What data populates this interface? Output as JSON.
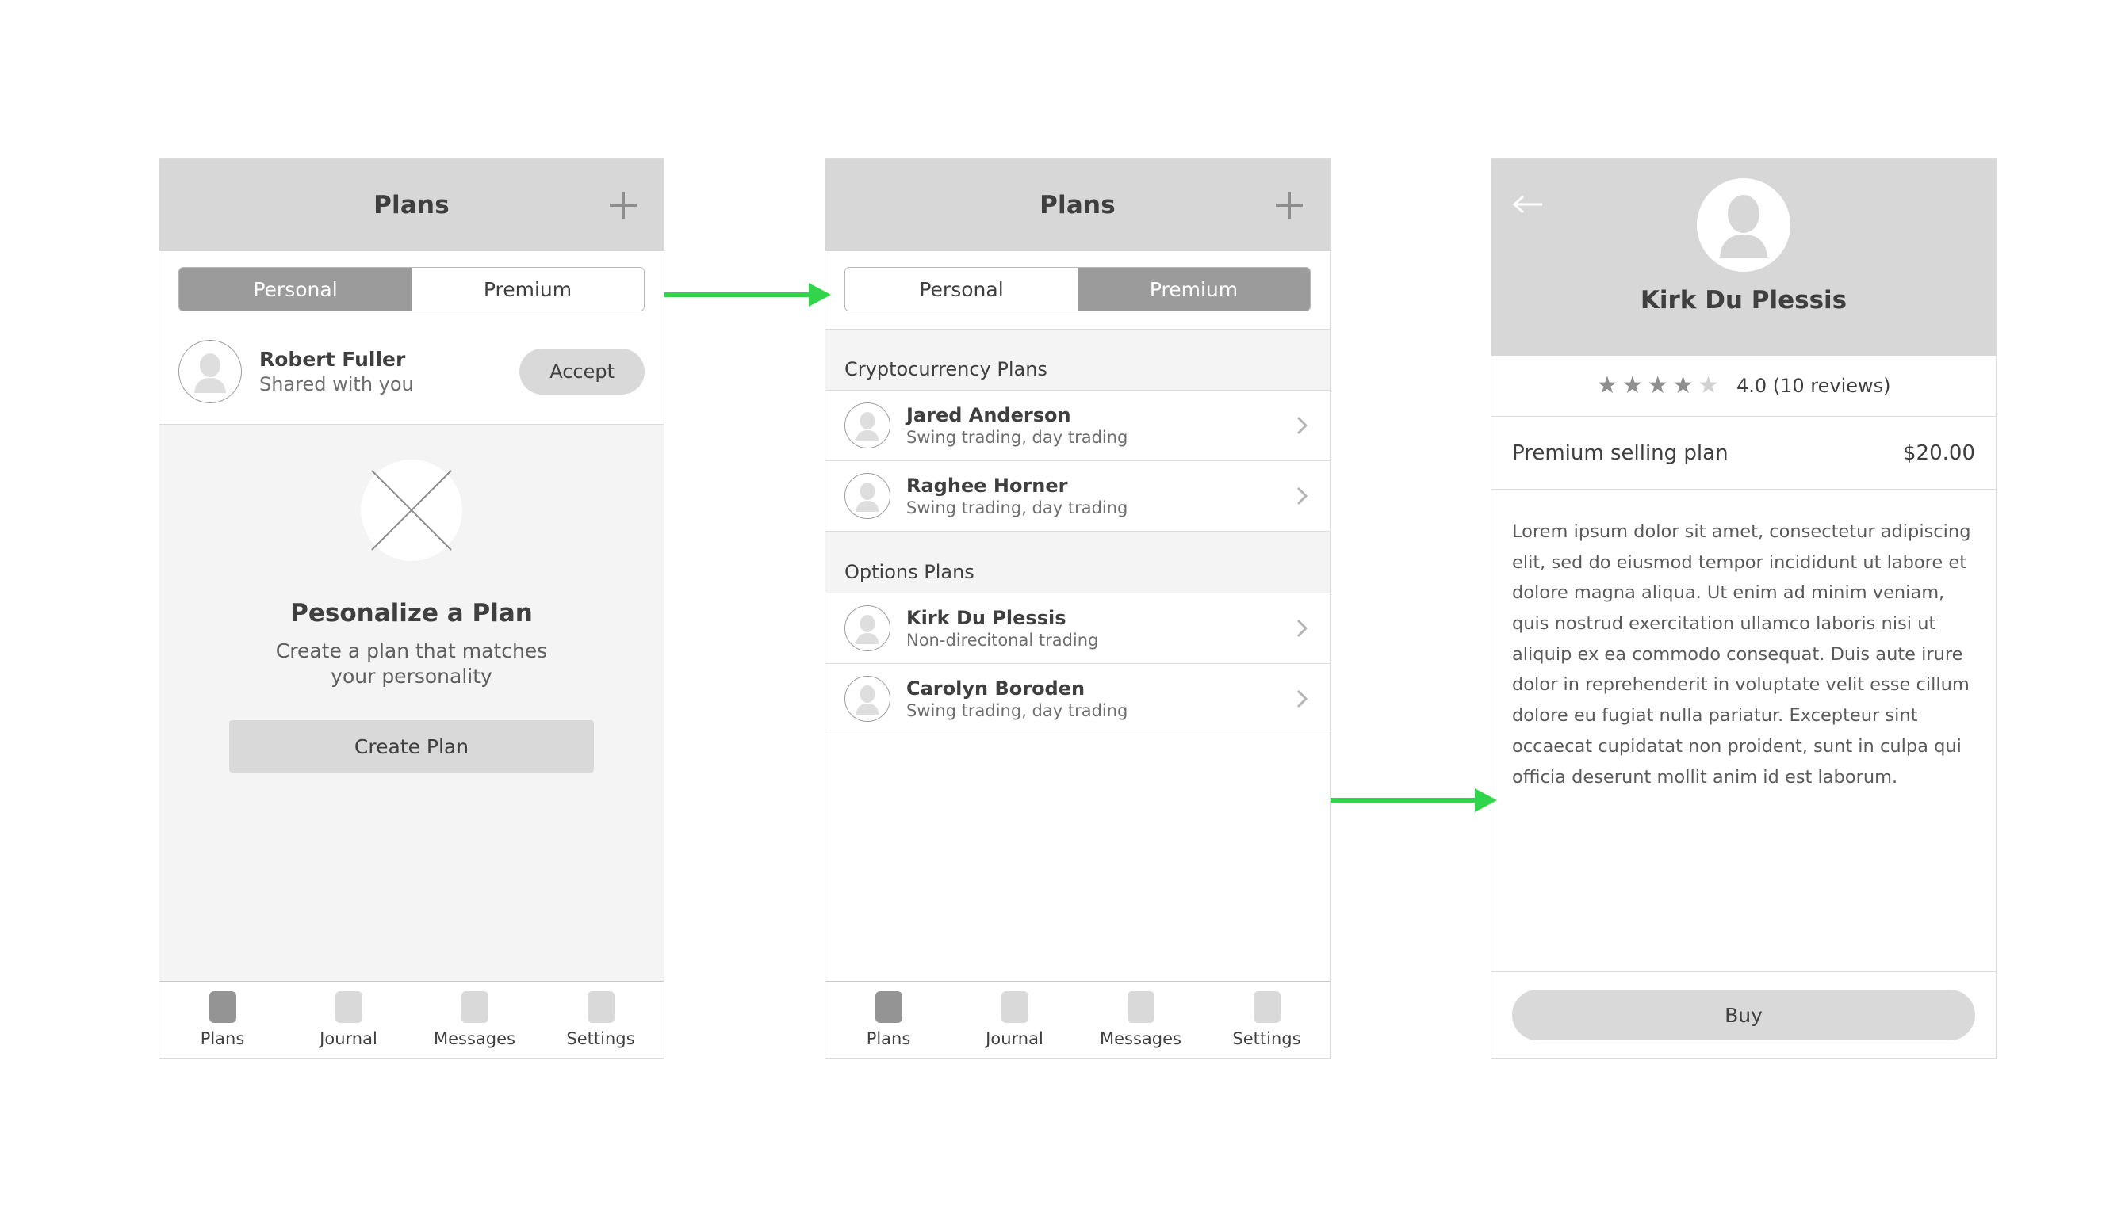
{
  "flow": {
    "arrow_color": "#32D44B",
    "arrows": [
      {
        "name": "arrow-plans-personal-to-premium"
      },
      {
        "name": "arrow-plan-row-to-detail"
      }
    ]
  },
  "icons": {
    "plus": "plus-icon",
    "chevron_right": "chevron-right-icon",
    "back_arrow": "back-arrow-icon",
    "person": "person-avatar-icon",
    "star_filled": "★",
    "star_empty": "★"
  },
  "screen1": {
    "appbar": {
      "title": "Plans",
      "add_label": "+"
    },
    "segments": [
      {
        "label": "Personal",
        "active": true
      },
      {
        "label": "Premium",
        "active": false
      }
    ],
    "invite": {
      "name": "Robert Fuller",
      "subtitle": "Shared with you",
      "action_label": "Accept"
    },
    "empty_state": {
      "title": "Pesonalize a Plan",
      "subtitle": "Create a plan that matches your personality",
      "button_label": "Create Plan"
    },
    "tabs": [
      {
        "label": "Plans",
        "active": true
      },
      {
        "label": "Journal",
        "active": false
      },
      {
        "label": "Messages",
        "active": false
      },
      {
        "label": "Settings",
        "active": false
      }
    ]
  },
  "screen2": {
    "appbar": {
      "title": "Plans",
      "add_label": "+"
    },
    "segments": [
      {
        "label": "Personal",
        "active": false
      },
      {
        "label": "Premium",
        "active": true
      }
    ],
    "sections": [
      {
        "header": "Cryptocurrency Plans",
        "rows": [
          {
            "name": "Jared Anderson",
            "subtitle": "Swing trading, day trading"
          },
          {
            "name": "Raghee Horner",
            "subtitle": "Swing trading, day trading"
          }
        ]
      },
      {
        "header": "Options Plans",
        "rows": [
          {
            "name": "Kirk Du Plessis",
            "subtitle": "Non-direcitonal trading"
          },
          {
            "name": "Carolyn Boroden",
            "subtitle": "Swing trading, day trading"
          }
        ]
      }
    ],
    "tabs": [
      {
        "label": "Plans",
        "active": true
      },
      {
        "label": "Journal",
        "active": false
      },
      {
        "label": "Messages",
        "active": false
      },
      {
        "label": "Settings",
        "active": false
      }
    ]
  },
  "screen3": {
    "back_label": "←",
    "profile_name": "Kirk Du Plessis",
    "rating": {
      "stars_filled": 4,
      "stars_total": 5,
      "text": "4.0 (10 reviews)"
    },
    "price": {
      "label": "Premium selling plan",
      "value": "$20.00"
    },
    "description": "Lorem ipsum dolor sit amet, consectetur adipiscing elit, sed do eiusmod tempor incididunt ut labore et dolore magna aliqua. Ut enim ad minim veniam, quis nostrud exercitation ullamco laboris nisi ut aliquip ex ea commodo consequat. Duis aute irure dolor in reprehenderit in voluptate velit esse cillum dolore eu fugiat nulla pariatur. Excepteur sint occaecat cupidatat non proident, sunt in culpa qui officia deserunt mollit anim id est laborum.",
    "buy_label": "Buy"
  }
}
